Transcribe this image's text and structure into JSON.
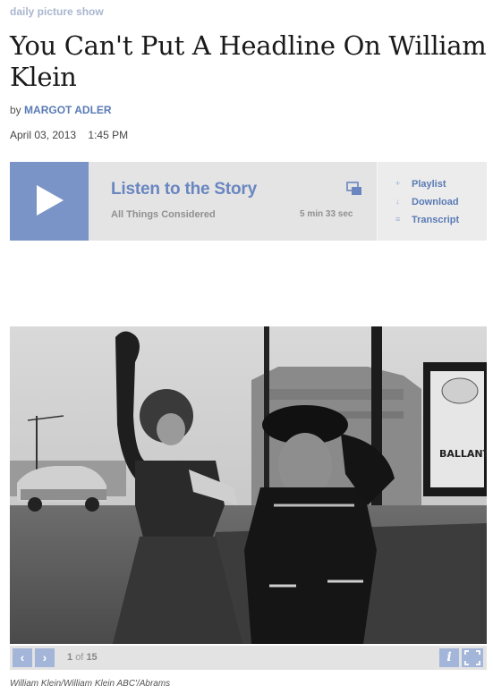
{
  "section": {
    "label": "daily picture show"
  },
  "article": {
    "headline": "You Can't Put A Headline On William Klein",
    "by_prefix": "by",
    "author": "MARGOT ADLER",
    "date": "April 03, 2013",
    "time": "1:45 PM"
  },
  "player": {
    "title": "Listen to the Story",
    "program": "All Things Considered",
    "duration": "5 min 33 sec",
    "links": [
      {
        "glyph": "+",
        "label": "Playlist"
      },
      {
        "glyph": "↓",
        "label": "Download"
      },
      {
        "glyph": "≡",
        "label": "Transcript"
      }
    ],
    "accent_color": "#7b94c7"
  },
  "gallery": {
    "prev_glyph": "‹",
    "next_glyph": "›",
    "current": "1",
    "separator": "of",
    "total": "15",
    "info_glyph": "i",
    "photo_sign_text": "BALLANT",
    "credit": "William Klein/William Klein ABC'/Abrams"
  }
}
